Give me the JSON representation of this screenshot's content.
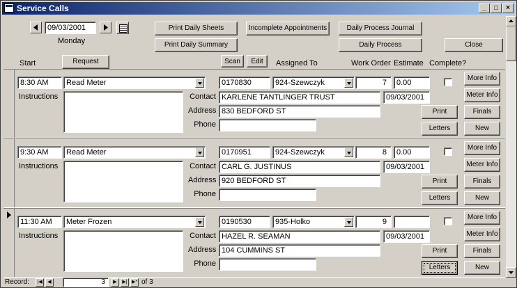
{
  "window": {
    "title": "Service Calls"
  },
  "header": {
    "date": "09/03/2001",
    "weekday": "Monday",
    "buttons": {
      "print_daily_sheets": "Print Daily Sheets",
      "print_daily_summary": "Print Daily Summary",
      "incomplete_appointments": "Incomplete Appointments",
      "daily_process_journal": "Daily Process Journal",
      "daily_process": "Daily Process",
      "close": "Close",
      "request": "Request",
      "scan": "Scan",
      "edit": "Edit"
    },
    "columns": {
      "start": "Start",
      "assigned_to": "Assigned To",
      "work_order": "Work Order",
      "estimate": "Estimate",
      "complete": "Complete?"
    }
  },
  "labels": {
    "instructions": "Instructions",
    "contact": "Contact",
    "address": "Address",
    "phone": "Phone",
    "more_info": "More Info",
    "meter_info": "Meter Info",
    "print": "Print",
    "finals": "Finals",
    "letters": "Letters",
    "new": "New"
  },
  "records": [
    {
      "start": "8:30 AM",
      "service": "Read Meter",
      "account": "0170830",
      "assigned": "924-Szewczyk",
      "work_order": "7",
      "estimate": "0.00",
      "contact": "KARLENE TANTLINGER TRUST",
      "date": "09/03/2001",
      "address": "830 BEDFORD ST",
      "phone": "",
      "instructions": "",
      "complete": false
    },
    {
      "start": "9:30 AM",
      "service": "Read Meter",
      "account": "0170951",
      "assigned": "924-Szewczyk",
      "work_order": "8",
      "estimate": "0.00",
      "contact": "CARL G. JUSTINUS",
      "date": "09/03/2001",
      "address": "920 BEDFORD ST",
      "phone": "",
      "instructions": "",
      "complete": false
    },
    {
      "start": "11:30 AM",
      "service": "Meter Frozen",
      "account": "0190530",
      "assigned": "935-Holko",
      "work_order": "9",
      "estimate": "",
      "contact": "HAZEL R. SEAMAN",
      "date": "09/03/2001",
      "address": "104 CUMMINS ST",
      "phone": "",
      "instructions": "",
      "complete": false
    }
  ],
  "navigation": {
    "record_label": "Record:",
    "current": "3",
    "of_label": "of 3"
  }
}
